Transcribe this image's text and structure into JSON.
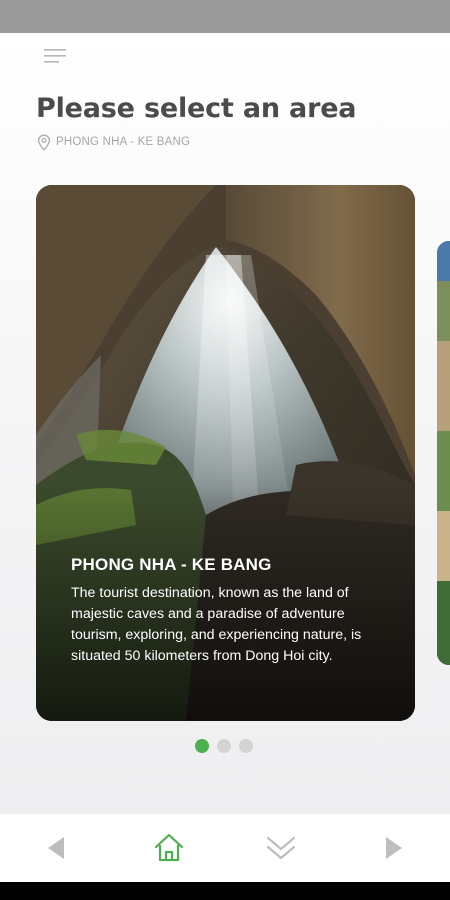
{
  "header": {
    "title": "Please select an area",
    "location": "PHONG NHA - KE BANG"
  },
  "carousel": {
    "cards": [
      {
        "title": "PHONG NHA - KE BANG",
        "description": "The tourist destination, known as the land of majestic caves and a paradise of adventure tourism, exploring, and experiencing nature, is situated 50 kilometers from Dong Hoi city."
      }
    ],
    "page_count": 3,
    "active_index": 0
  },
  "icons": {
    "menu": "menu-icon",
    "location": "location-pin-icon",
    "previous": "triangle-left-icon",
    "home": "home-icon",
    "down": "double-chevron-down-icon",
    "next": "triangle-right-icon"
  },
  "colors": {
    "accent": "#4caf50",
    "title": "#4b4b4b",
    "muted": "#a6a6a6",
    "status_bar": "#9a9a9a"
  }
}
